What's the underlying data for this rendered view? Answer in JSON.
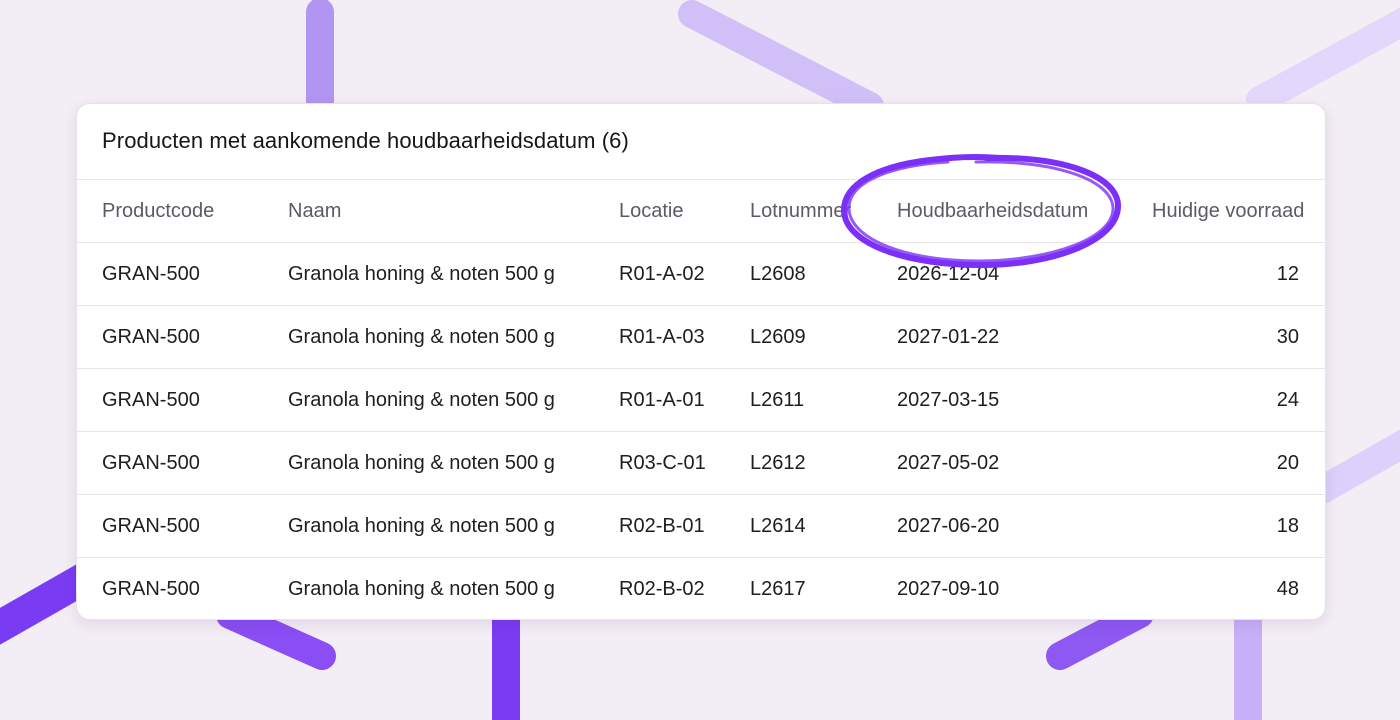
{
  "panel": {
    "title": "Producten met aankomende houdbaarheidsdatum (6)"
  },
  "table": {
    "headers": [
      "Productcode",
      "Naam",
      "Locatie",
      "Lotnummer",
      "Houdbaarheidsdatum",
      "Huidige voorraad"
    ],
    "rows": [
      [
        "GRAN-500",
        "Granola honing & noten 500 g",
        "R01-A-02",
        "L2608",
        "2026-12-04",
        "12"
      ],
      [
        "GRAN-500",
        "Granola honing & noten 500 g",
        "R01-A-03",
        "L2609",
        "2027-01-22",
        "30"
      ],
      [
        "GRAN-500",
        "Granola honing & noten 500 g",
        "R01-A-01",
        "L2611",
        "2027-03-15",
        "24"
      ],
      [
        "GRAN-500",
        "Granola honing & noten 500 g",
        "R03-C-01",
        "L2612",
        "2027-05-02",
        "20"
      ],
      [
        "GRAN-500",
        "Granola honing & noten 500 g",
        "R02-B-01",
        "L2614",
        "2027-06-20",
        "18"
      ],
      [
        "GRAN-500",
        "Granola honing & noten 500 g",
        "R02-B-02",
        "L2617",
        "2027-09-10",
        "48"
      ]
    ]
  },
  "colors": {
    "accent": "#7b2ff7",
    "background": "#f3edf5",
    "card": "#ffffff"
  }
}
